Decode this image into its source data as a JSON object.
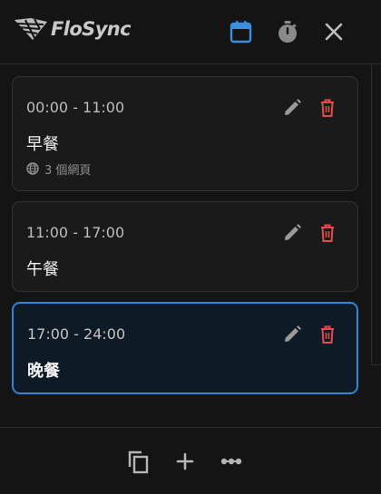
{
  "app": {
    "name": "FloSync"
  },
  "header": {
    "icons": [
      "calendar-icon",
      "timer-icon",
      "close-icon"
    ],
    "accent_color": "#3b8fe0"
  },
  "schedule": [
    {
      "time": "00:00 - 11:00",
      "label": "早餐",
      "subtitle": "3 個網頁",
      "selected": false
    },
    {
      "time": "11:00 - 17:00",
      "label": "午餐",
      "selected": false
    },
    {
      "time": "17:00 - 24:00",
      "label": "晚餐",
      "selected": true
    }
  ],
  "colors": {
    "delete": "#e64b4b",
    "selected_border": "#2f86d6"
  },
  "footer": {
    "icons": [
      "copy-icon",
      "plus-icon",
      "more-icon"
    ]
  }
}
